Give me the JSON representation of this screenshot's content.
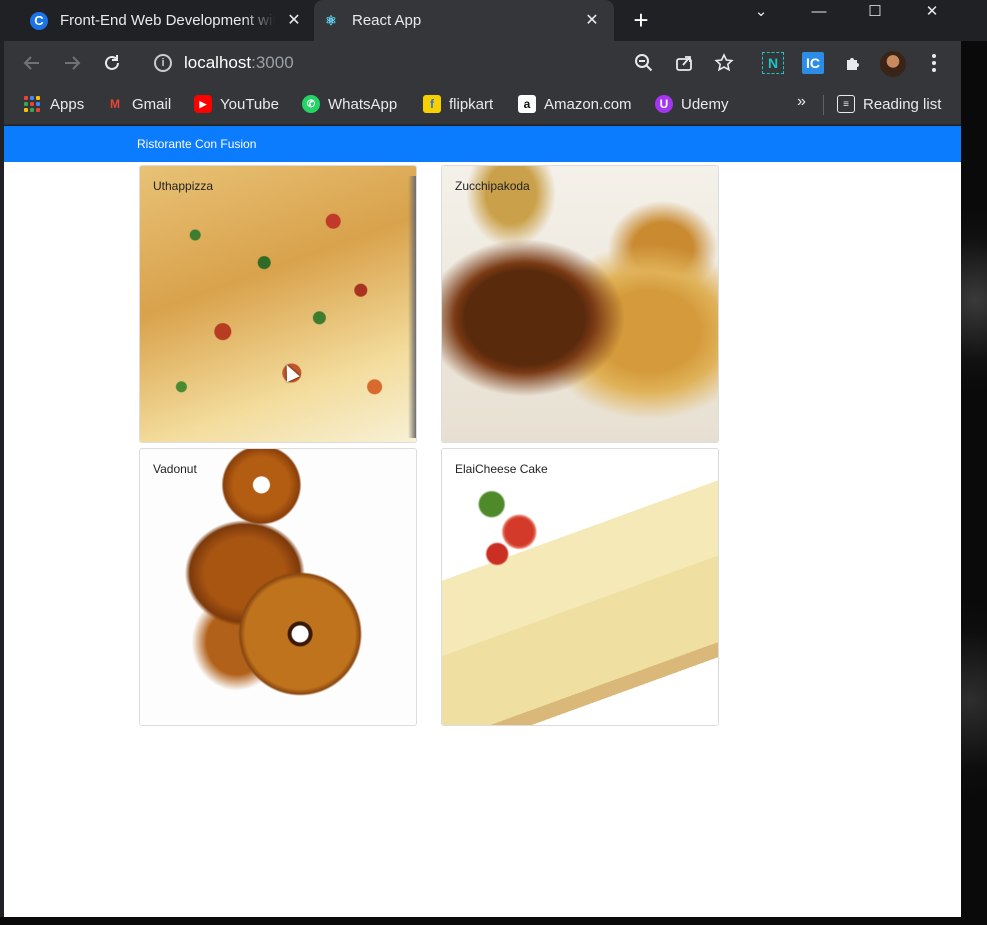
{
  "browser": {
    "tabs": [
      {
        "label": "Front-End Web Development wit",
        "icon": "coursera-icon",
        "active": false
      },
      {
        "label": "React App",
        "icon": "react-icon",
        "active": true
      }
    ],
    "close_glyph": "✕",
    "newtab_glyph": "+",
    "url_host": "localhost",
    "url_port": ":3000",
    "window_controls": {
      "dropdown": "⌄",
      "minimize": "—",
      "maximize": "☐",
      "close": "✕"
    }
  },
  "bookmarks": {
    "items": [
      {
        "label": "Apps",
        "icon": "apps-grid-icon"
      },
      {
        "label": "Gmail",
        "icon": "gmail-icon"
      },
      {
        "label": "YouTube",
        "icon": "youtube-icon"
      },
      {
        "label": "WhatsApp",
        "icon": "whatsapp-icon"
      },
      {
        "label": "flipkart",
        "icon": "flipkart-icon"
      },
      {
        "label": "Amazon.com",
        "icon": "amazon-icon"
      },
      {
        "label": "Udemy",
        "icon": "udemy-icon"
      }
    ],
    "more": "»",
    "reading_list": "Reading list"
  },
  "page": {
    "brand": "Ristorante Con Fusion",
    "dishes": [
      {
        "name": "Uthappizza"
      },
      {
        "name": "Zucchipakoda"
      },
      {
        "name": "Vadonut"
      },
      {
        "name": "ElaiCheese Cake"
      }
    ]
  },
  "colors": {
    "navbar": "#0c7cff",
    "chrome_dark": "#202124",
    "chrome_toolbar": "#35363a"
  }
}
